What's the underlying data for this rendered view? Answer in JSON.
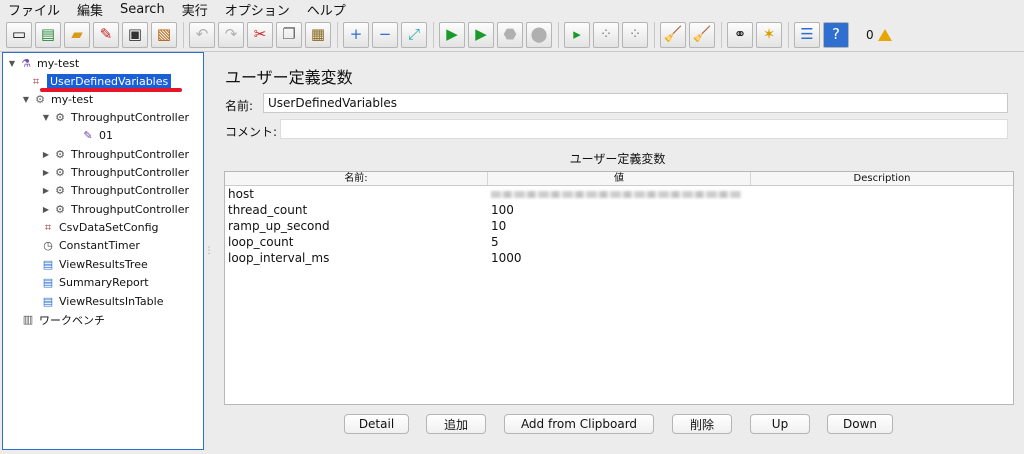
{
  "menu": [
    "ファイル",
    "編集",
    "Search",
    "実行",
    "オプション",
    "ヘルプ"
  ],
  "toolbar": {
    "icons": [
      "new-icon",
      "templates-icon",
      "open-icon",
      "close-icon",
      "save-icon",
      "save-as-icon",
      "undo-icon",
      "redo-icon",
      "cut-icon",
      "copy-icon",
      "paste-icon",
      "expand-icon",
      "collapse-icon",
      "toggle-icon",
      "start-icon",
      "start-no-pause-icon",
      "stop-icon",
      "shutdown-icon",
      "remote-start-icon",
      "remote-stop-icon",
      "remote-shutdown-icon",
      "clear-icon",
      "clear-all-icon",
      "search-icon",
      "reset-search-icon",
      "function-helper-icon",
      "help-icon"
    ],
    "error_count": "0"
  },
  "tree": [
    {
      "label": "my-test",
      "icon": "testplan-icon",
      "twisty": "▼",
      "level": 0
    },
    {
      "label": "UserDefinedVariables",
      "icon": "config-icon",
      "twisty": "",
      "level": 1,
      "selected": true
    },
    {
      "label": "my-test",
      "icon": "threadgroup-icon",
      "twisty": "▼",
      "level": 1
    },
    {
      "label": "ThroughputController",
      "icon": "controller-icon",
      "twisty": "▼",
      "level": 2
    },
    {
      "label": "01",
      "icon": "sampler-icon",
      "twisty": "",
      "level": 3
    },
    {
      "label": "ThroughputController",
      "icon": "controller-icon",
      "twisty": "▶",
      "level": 2
    },
    {
      "label": "ThroughputController",
      "icon": "controller-icon",
      "twisty": "▶",
      "level": 2
    },
    {
      "label": "ThroughputController",
      "icon": "controller-icon",
      "twisty": "▶",
      "level": 2
    },
    {
      "label": "ThroughputController",
      "icon": "controller-icon",
      "twisty": "▶",
      "level": 2
    },
    {
      "label": "CsvDataSetConfig",
      "icon": "config-icon",
      "twisty": "",
      "level": 1
    },
    {
      "label": "ConstantTimer",
      "icon": "timer-icon",
      "twisty": "",
      "level": 1
    },
    {
      "label": "ViewResultsTree",
      "icon": "listener-icon",
      "twisty": "",
      "level": 1
    },
    {
      "label": "SummaryReport",
      "icon": "listener-icon",
      "twisty": "",
      "level": 1
    },
    {
      "label": "ViewResultsInTable",
      "icon": "listener-icon",
      "twisty": "",
      "level": 1
    },
    {
      "label": "ワークベンチ",
      "icon": "workbench-icon",
      "twisty": "",
      "level": 0
    }
  ],
  "panel": {
    "title": "ユーザー定義変数",
    "name_label": "名前:",
    "name_value": "UserDefinedVariables",
    "comment_label": "コメント:",
    "comment_value": "",
    "table_caption": "ユーザー定義変数",
    "columns": [
      "名前:",
      "値",
      "Description"
    ],
    "rows": [
      {
        "name": "host",
        "value": "",
        "description": ""
      },
      {
        "name": "thread_count",
        "value": "100",
        "description": ""
      },
      {
        "name": "ramp_up_second",
        "value": "10",
        "description": ""
      },
      {
        "name": "loop_count",
        "value": "5",
        "description": ""
      },
      {
        "name": "loop_interval_ms",
        "value": "1000",
        "description": ""
      }
    ]
  },
  "buttons": {
    "detail": "Detail",
    "add": "追加",
    "add_clipboard": "Add from Clipboard",
    "delete": "削除",
    "up": "Up",
    "down": "Down"
  },
  "colors": {
    "selection": "#1a5fd6",
    "annotation_underline": "#e8142c",
    "tree_border": "#2c6fd1"
  }
}
